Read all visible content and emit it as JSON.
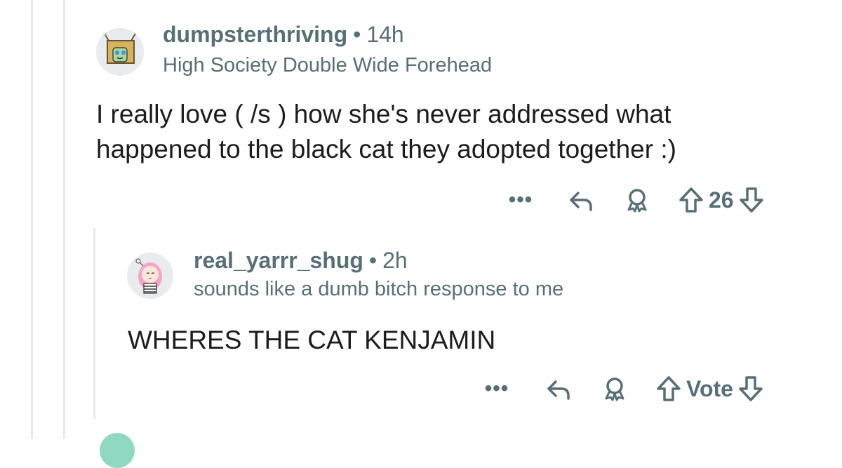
{
  "comment1": {
    "username": "dumpsterthriving",
    "separator": "•",
    "time": "14h",
    "flair": "High Society Double Wide Forehead",
    "body": "I really love ( /s ) how she's never addressed what happened to the black cat they adopted together :)",
    "more_label": "•••",
    "score": "26",
    "avatar_icon": "box-character-avatar"
  },
  "comment2": {
    "username": "real_yarrr_shug",
    "separator": "•",
    "time": "2h",
    "flair": "sounds like a dumb bitch response to me",
    "body": "WHERES THE CAT KENJAMIN",
    "more_label": "•••",
    "score": "Vote",
    "avatar_icon": "pink-hair-girl-avatar"
  },
  "colors": {
    "meta": "#576f76",
    "thread_line": "#e6e8ea",
    "text": "#1c1c1c"
  }
}
